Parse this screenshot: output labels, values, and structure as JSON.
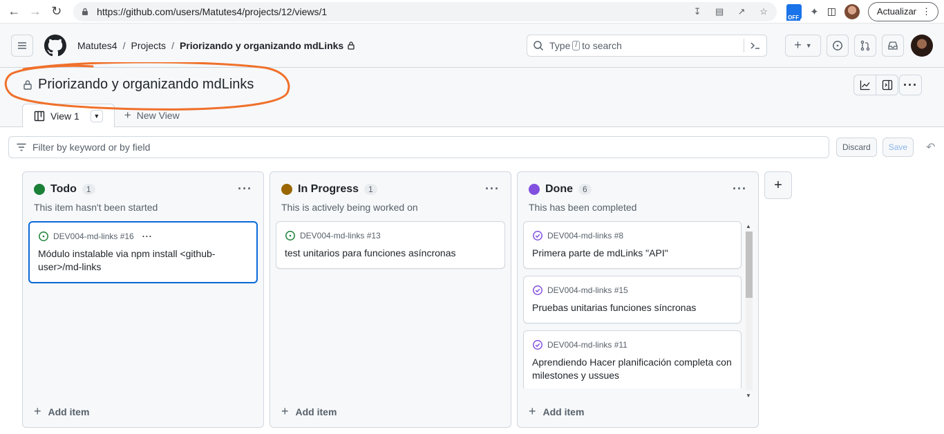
{
  "browser": {
    "url": "https://github.com/users/Matutes4/projects/12/views/1",
    "update_label": "Actualizar",
    "ext_badge": "OFF"
  },
  "header": {
    "breadcrumbs": [
      "Matutes4",
      "Projects",
      "Priorizando y organizando mdLinks"
    ],
    "search_prefix": "Type",
    "search_key": "/",
    "search_suffix": "to search"
  },
  "project": {
    "title": "Priorizando y organizando mdLinks",
    "tabs": [
      {
        "label": "View 1"
      }
    ],
    "new_view_label": "New View"
  },
  "filter": {
    "placeholder": "Filter by keyword or by field",
    "discard_label": "Discard",
    "save_label": "Save"
  },
  "columns": [
    {
      "name": "Todo",
      "count": "1",
      "color": "#1a7f37",
      "description": "This item hasn't been started",
      "add_label": "Add item",
      "cards": [
        {
          "ref": "DEV004-md-links #16",
          "title": "Módulo instalable via npm install <github-user>/md-links",
          "status": "open"
        }
      ]
    },
    {
      "name": "In Progress",
      "count": "1",
      "color": "#9a6700",
      "description": "This is actively being worked on",
      "add_label": "Add item",
      "cards": [
        {
          "ref": "DEV004-md-links #13",
          "title": "test unitarios para funciones asíncronas",
          "status": "open"
        }
      ]
    },
    {
      "name": "Done",
      "count": "6",
      "color": "#8250df",
      "description": "This has been completed",
      "add_label": "Add item",
      "cards": [
        {
          "ref": "DEV004-md-links #8",
          "title": "Primera parte de mdLinks \"API\"",
          "status": "closed"
        },
        {
          "ref": "DEV004-md-links #15",
          "title": "Pruebas unitarias funciones síncronas",
          "status": "closed"
        },
        {
          "ref": "DEV004-md-links #11",
          "title": "Aprendiendo Hacer planificación completa con milestones y ussues",
          "status": "closed"
        }
      ]
    }
  ],
  "colors": {
    "accent": "#0969da",
    "annotation": "#f0702a"
  }
}
